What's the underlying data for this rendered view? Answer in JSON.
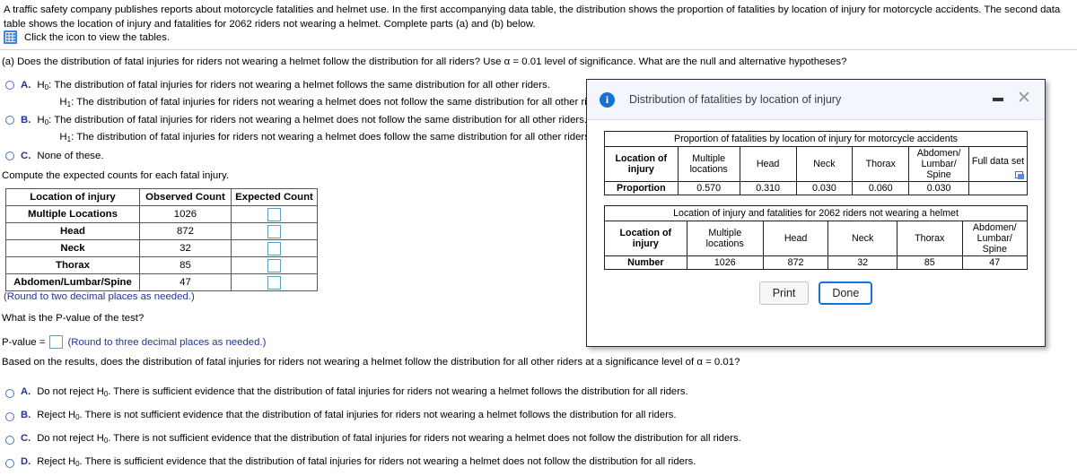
{
  "intro": {
    "paragraph": "A traffic safety company publishes reports about motorcycle fatalities and helmet use. In the first accompanying data table, the distribution shows the proportion of fatalities by location of injury for motorcycle accidents. The second data table shows the location of injury and fatalities for 2062 riders not wearing a helmet. Complete parts (a) and (b) below.",
    "icon_line": "Click the icon to view the tables.",
    "icon": "table-grid-icon"
  },
  "part_a": {
    "question": "(a) Does the distribution of fatal injuries for riders not wearing a helmet follow the distribution for all riders? Use α = 0.01 level of significance. What are the null and alternative hypotheses?",
    "choices": [
      {
        "label": "A.",
        "line1_prefix": "H",
        "line1_sub": "0",
        "line1": ": The distribution of fatal injuries for riders not wearing a helmet follows the same distribution for all other riders.",
        "line2_prefix": "H",
        "line2_sub": "1",
        "line2": ": The distribution of fatal injuries for riders not wearing a helmet does not follow the same distribution for all other riders."
      },
      {
        "label": "B.",
        "line1_prefix": "H",
        "line1_sub": "0",
        "line1": ": The distribution of fatal injuries for riders not wearing a helmet does not follow the same distribution for all other riders.",
        "line2_prefix": "H",
        "line2_sub": "1",
        "line2": ": The distribution of fatal injuries for riders not wearing a helmet does follow the same distribution for all other riders."
      },
      {
        "label": "C.",
        "line1_prefix": "",
        "line1_sub": "",
        "line1": "None of these.",
        "line2_prefix": "",
        "line2_sub": "",
        "line2": ""
      }
    ]
  },
  "expected": {
    "prompt": "Compute the expected counts for each fatal injury.",
    "headers": [
      "Location of injury",
      "Observed Count",
      "Expected Count"
    ],
    "rows": [
      {
        "location": "Multiple Locations",
        "observed": "1026",
        "expected": ""
      },
      {
        "location": "Head",
        "observed": "872",
        "expected": ""
      },
      {
        "location": "Neck",
        "observed": "32",
        "expected": ""
      },
      {
        "location": "Thorax",
        "observed": "85",
        "expected": ""
      },
      {
        "location": "Abdomen/Lumbar/Spine",
        "observed": "47",
        "expected": ""
      }
    ],
    "round_note": "(Round to two decimal places as needed.)"
  },
  "pvalue": {
    "question": "What is the P-value of the test?",
    "label": "P-value =",
    "value": "",
    "note": "(Round to three decimal places as needed.)"
  },
  "part_b": {
    "question": "Based on the results, does the distribution of fatal injuries for riders not wearing a helmet follow the distribution for all other riders at a significance level of α = 0.01?",
    "choices": [
      {
        "label": "A.",
        "pre": "Do not reject H",
        "sub": "0",
        "post": ". There is sufficient evidence that the distribution of fatal injuries for riders not wearing a helmet follows the distribution for all riders."
      },
      {
        "label": "B.",
        "pre": "Reject H",
        "sub": "0",
        "post": ". There is not sufficient evidence that the distribution of fatal injuries for riders not wearing a helmet follows the distribution for all riders."
      },
      {
        "label": "C.",
        "pre": "Do not reject H",
        "sub": "0",
        "post": ". There is not sufficient evidence that the distribution of fatal injuries for riders not wearing a helmet does not follow the distribution for all riders."
      },
      {
        "label": "D.",
        "pre": "Reject H",
        "sub": "0",
        "post": ". There is sufficient evidence that the distribution of fatal injuries for riders not wearing a helmet does not follow the distribution for all riders."
      }
    ]
  },
  "dialog": {
    "title": "Distribution of fatalities by location of injury",
    "info_icon": "info-icon",
    "minimize_icon": "minimize-icon",
    "close_icon": "close-icon",
    "table1": {
      "caption": "Proportion of fatalities by location of injury for motorcycle accidents",
      "headers": [
        "Location of injury",
        "Multiple locations",
        "Head",
        "Neck",
        "Thorax",
        "Abdomen/ Lumbar/ Spine",
        "Full data set"
      ],
      "header_multiline": {
        "c0_l1": "Location of",
        "c0_l2": "injury",
        "c1_l1": "Multiple",
        "c1_l2": "locations",
        "c5_l1": "Abdomen/",
        "c5_l2": "Lumbar/",
        "c5_l3": "Spine",
        "c6": "Full data set"
      },
      "row_label": "Proportion",
      "values": [
        "0.570",
        "0.310",
        "0.030",
        "0.060",
        "0.030"
      ],
      "copy_icon": "copy-icon"
    },
    "table2": {
      "caption": "Location of injury and fatalities for 2062 riders not wearing a helmet",
      "header_multiline": {
        "c0_l1": "Location of",
        "c0_l2": "injury",
        "c1_l1": "Multiple",
        "c1_l2": "locations",
        "c2": "Head",
        "c3": "Neck",
        "c4": "Thorax",
        "c5_l1": "Abdomen/",
        "c5_l2": "Lumbar/",
        "c5_l3": "Spine"
      },
      "row_label": "Number",
      "values": [
        "1026",
        "872",
        "32",
        "85",
        "47"
      ]
    },
    "buttons": {
      "print": "Print",
      "done": "Done"
    }
  },
  "colors": {
    "link_blue": "#22339c",
    "accent_blue": "#1673d1",
    "input_border": "#5a9fbe"
  }
}
